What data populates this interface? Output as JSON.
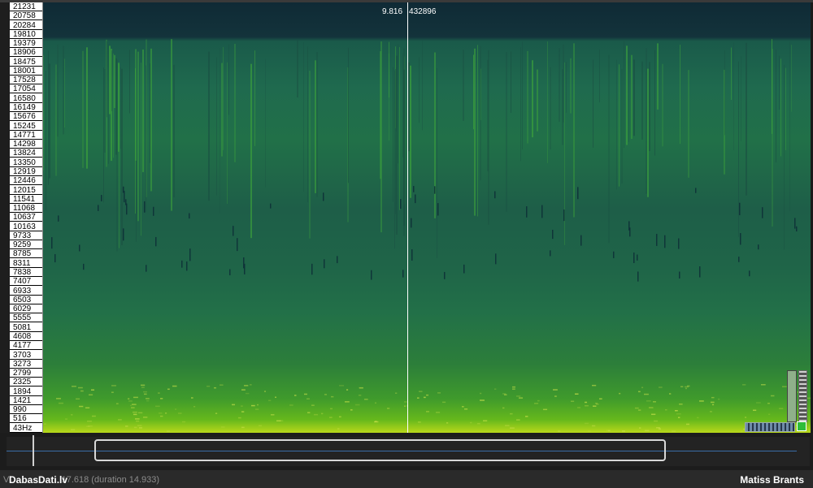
{
  "frequency_axis": {
    "labels": [
      "21231",
      "20758",
      "20284",
      "19810",
      "19379",
      "18906",
      "18475",
      "18001",
      "17528",
      "17054",
      "16580",
      "16149",
      "15676",
      "15245",
      "14771",
      "14298",
      "13824",
      "13350",
      "12919",
      "12446",
      "12015",
      "11541",
      "11068",
      "10637",
      "10163",
      "9733",
      "9259",
      "8785",
      "8311",
      "7838",
      "7407",
      "6933",
      "6503",
      "6029",
      "5555",
      "5081",
      "4608",
      "4177",
      "3703",
      "3273",
      "2799",
      "2325",
      "1894",
      "1421",
      "990",
      "516",
      "43Hz"
    ]
  },
  "cursor": {
    "time": "9.816",
    "frequency": "432896"
  },
  "status": {
    "prefix": "Vi",
    "position_text": "17.618 (duration 14.933)"
  },
  "brand": "DabasDati.lv",
  "author": "Matiss Brants",
  "colors": {
    "spectrogram_high": "#b9d81a",
    "spectrogram_mid": "#217048",
    "spectrogram_top": "#0f2a35",
    "overview_line": "#3a6da8",
    "toggle_green": "#2ebd3a"
  }
}
